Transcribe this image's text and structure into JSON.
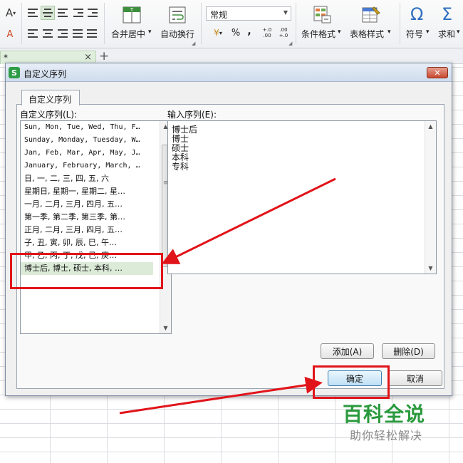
{
  "ribbon": {
    "font_size_icon": "A",
    "fill_icon": "A",
    "merge_center_label": "合并居中",
    "wrap_text_label": "自动换行",
    "number_format_value": "常规",
    "percent_symbol": "%",
    "comma_symbol": ",",
    "increase_decimal": "+.0 .00",
    "decrease_decimal": ".00 +.0",
    "conditional_format_label": "条件格式",
    "table_style_label": "表格样式",
    "symbol_icon": "Ω",
    "symbol_label": "符号",
    "sum_icon": "Σ",
    "sum_label": "求和",
    "dropdown_glyph": "▾"
  },
  "sheet": {
    "doc_tab_label": "*",
    "doc_tab_close": "×",
    "new_tab": "+"
  },
  "dialog": {
    "title": "自定义序列",
    "logo_letter": "S",
    "close_glyph": "✕",
    "tab_label": "自定义序列",
    "list_label": "自定义序列(L):",
    "input_label": "输入序列(E):",
    "list_items": [
      "Sun, Mon, Tue, Wed, Thu, F…",
      "Sunday, Monday, Tuesday, W…",
      "Jan, Feb, Mar, Apr, May, J…",
      "January, February, March, …",
      "日, 一, 二, 三, 四, 五, 六",
      "星期日, 星期一, 星期二, 星…",
      "一月, 二月, 三月, 四月, 五…",
      "第一季, 第二季, 第三季, 第…",
      "正月, 二月, 三月, 四月, 五…",
      "子, 丑, 寅, 卯, 辰, 巳, 午…",
      "甲, 乙, 丙, 丁, 戊, 己, 庚…",
      "博士后, 博士, 硕士, 本科, …"
    ],
    "input_lines": [
      "博士后",
      "博士",
      "硕士",
      "本科",
      "专科"
    ],
    "add_button": "添加(A)",
    "delete_button": "删除(D)",
    "ok_button": "确定",
    "cancel_button": "取消",
    "scroll_up": "▲",
    "scroll_down": "▼",
    "scroll_grip": "≡"
  },
  "watermark": {
    "title": "百科全说",
    "subtitle": "助你轻松解决"
  },
  "colors": {
    "annotation_red": "#e1141a",
    "watermark_green": "#2a9a3d",
    "selected_row": "#dcebd8",
    "app_green": "#2f9d47"
  }
}
